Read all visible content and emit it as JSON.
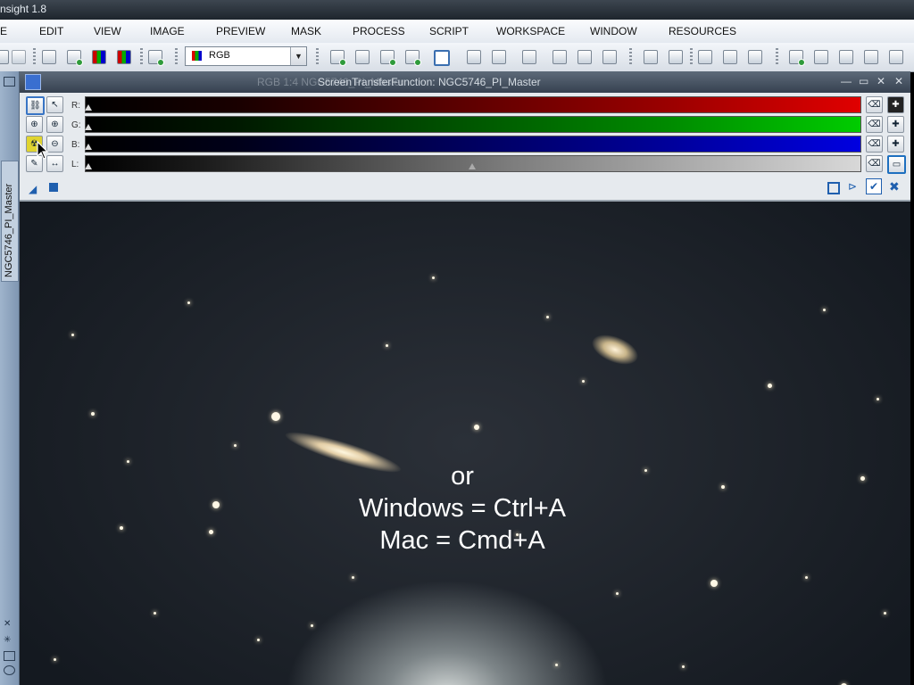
{
  "app": {
    "title": "nsight 1.8"
  },
  "menu": [
    "E",
    "EDIT",
    "VIEW",
    "IMAGE",
    "PREVIEW",
    "MASK",
    "PROCESS",
    "SCRIPT",
    "WORKSPACE",
    "WINDOW",
    "RESOURCES"
  ],
  "toolbar": {
    "channel_select": "RGB"
  },
  "sidebar": {
    "image_tab": "NGC5746_PI_Master"
  },
  "image_window": {
    "title_behind": "RGB 1:4 NGC5746_PI_Master"
  },
  "stf": {
    "title": "ScreenTransferFunction: NGC5746_PI_Master",
    "channels": [
      "R:",
      "G:",
      "B:",
      "L:"
    ]
  },
  "overlay": {
    "line1": "or",
    "line2": "Windows = Ctrl+A",
    "line3": "Mac = Cmd+A"
  }
}
